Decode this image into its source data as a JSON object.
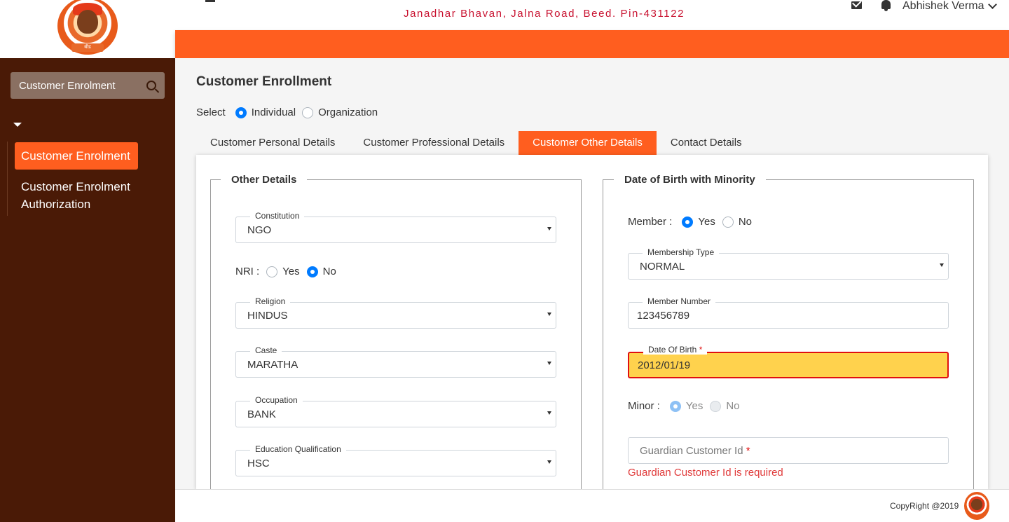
{
  "header": {
    "title_partial": "",
    "address": "Janadhar Bhavan, Jalna Road, Beed. Pin-431122",
    "user_name": "Abhishek Verma",
    "icons": [
      "menu-icon",
      "mail-icon",
      "bell-icon",
      "chevron-down-icon"
    ]
  },
  "sidebar": {
    "search_label": "Customer Enrolment",
    "items": [
      {
        "label": "Customer Enrolment",
        "active": true
      },
      {
        "label": "Customer Enrolment Authorization",
        "active": false
      }
    ]
  },
  "page": {
    "title": "Customer Enrollment",
    "select_label": "Select",
    "select_options": [
      "Individual",
      "Organization"
    ],
    "selected": "Individual"
  },
  "tabs": [
    {
      "label": "Customer Personal Details",
      "active": false
    },
    {
      "label": "Customer Professional Details",
      "active": false
    },
    {
      "label": "Customer Other Details",
      "active": true
    },
    {
      "label": "Contact Details",
      "active": false
    }
  ],
  "other_details": {
    "legend": "Other Details",
    "constitution": {
      "label": "Constitution",
      "value": "NGO"
    },
    "nri": {
      "label": "NRI :",
      "yes": "Yes",
      "no": "No",
      "selected": "No"
    },
    "religion": {
      "label": "Religion",
      "value": "HINDUS"
    },
    "caste": {
      "label": "Caste",
      "value": "MARATHA"
    },
    "occupation": {
      "label": "Occupation",
      "value": "BANK"
    },
    "education": {
      "label": "Education Qualification",
      "value": "HSC"
    }
  },
  "dob_minority": {
    "legend": "Date of Birth with Minority",
    "member": {
      "label": "Member :",
      "yes": "Yes",
      "no": "No",
      "selected": "Yes"
    },
    "membership_type": {
      "label": "Membership Type",
      "value": "NORMAL"
    },
    "member_number": {
      "label": "Member Number",
      "value": "123456789"
    },
    "dob": {
      "label": "Date Of Birth",
      "required_mark": "*",
      "value": "2012/01/19"
    },
    "minor": {
      "label": "Minor :",
      "yes": "Yes",
      "no": "No",
      "selected": "Yes"
    },
    "guardian": {
      "placeholder": "Guardian Customer Id",
      "required_mark": "*",
      "error": "Guardian Customer Id is required"
    }
  },
  "footer": {
    "copyright": "CopyRight @2019"
  },
  "colors": {
    "accent": "#ff5e1f",
    "sidebar_bg": "#4a1a06",
    "brand_red": "#c8102e",
    "error_fill": "#ffd24d",
    "error_border": "#e01010",
    "radio_blue": "#007bff"
  }
}
